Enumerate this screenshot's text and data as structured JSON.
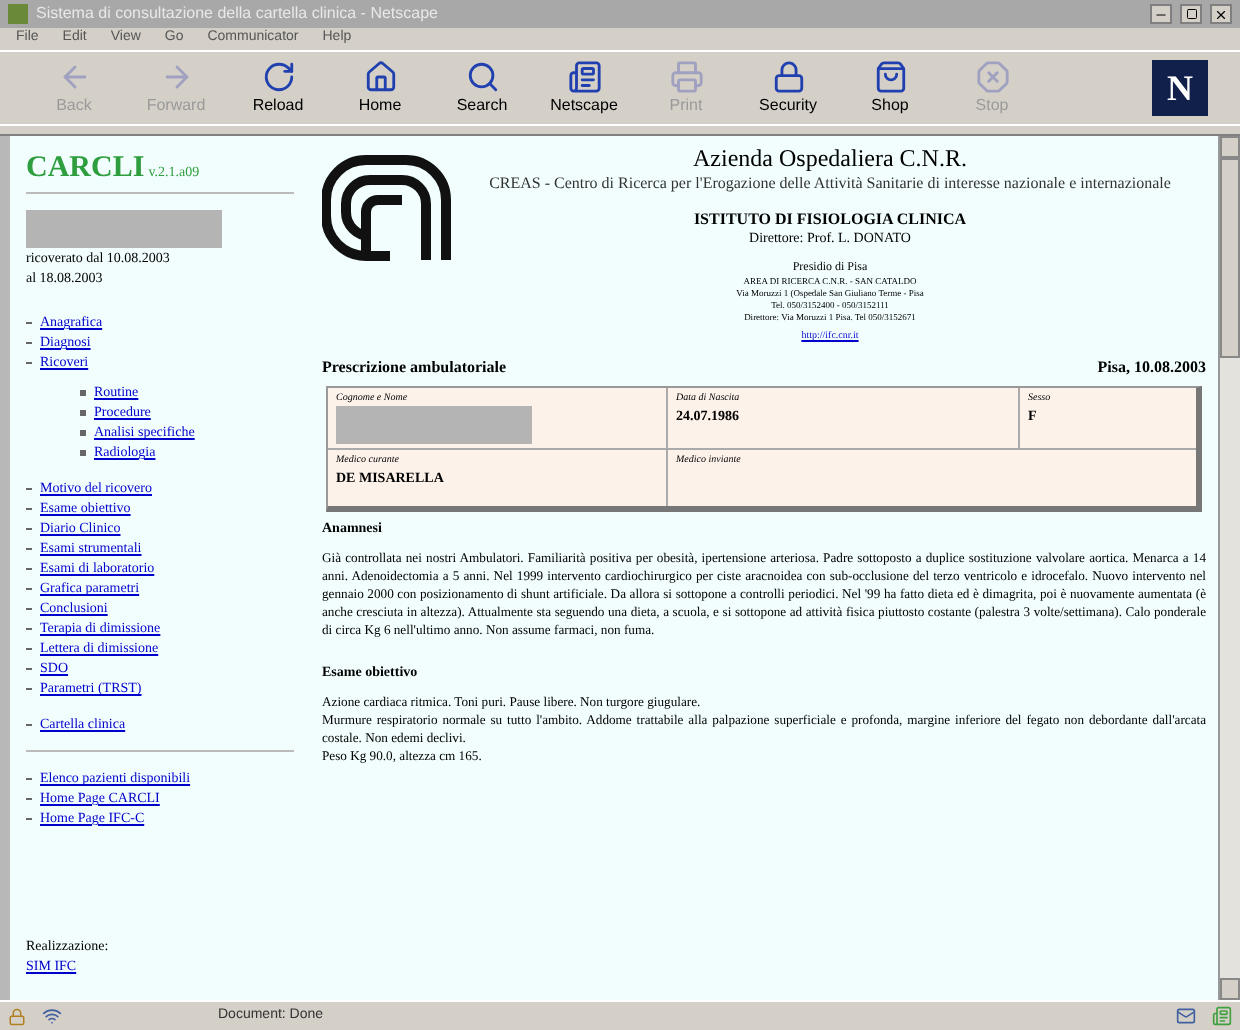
{
  "window": {
    "title": "Sistema di consultazione della cartella clinica - Netscape"
  },
  "menu": [
    "File",
    "Edit",
    "View",
    "Go",
    "Communicator",
    "Help"
  ],
  "toolbar": [
    {
      "kind": "back",
      "label": "Back",
      "disabled": true
    },
    {
      "kind": "forward",
      "label": "Forward",
      "disabled": true
    },
    {
      "kind": "reload",
      "label": "Reload",
      "disabled": false
    },
    {
      "kind": "home",
      "label": "Home",
      "disabled": false
    },
    {
      "kind": "search",
      "label": "Search",
      "disabled": false
    },
    {
      "kind": "netscape",
      "label": "Netscape",
      "disabled": false
    },
    {
      "kind": "print",
      "label": "Print",
      "disabled": true
    },
    {
      "kind": "security",
      "label": "Security",
      "disabled": false
    },
    {
      "kind": "shop",
      "label": "Shop",
      "disabled": false
    },
    {
      "kind": "stop",
      "label": "Stop",
      "disabled": true
    }
  ],
  "throbber": "N",
  "sidebar": {
    "app_name": "CARCLI",
    "version": "v.2.1.a09",
    "stay": [
      "ricoverato dal 10.08.2003",
      "al 18.08.2003"
    ],
    "links": [
      {
        "label": "Anagrafica"
      },
      {
        "label": "Diagnosi"
      },
      {
        "label": "Ricoveri",
        "children": [
          {
            "label": "Routine"
          },
          {
            "label": "Procedure"
          },
          {
            "label": "Analisi specifiche"
          },
          {
            "label": "Radiologia"
          }
        ]
      }
    ],
    "sections": [
      {
        "label": "Motivo del ricovero"
      },
      {
        "label": "Esame obiettivo"
      },
      {
        "label": "Diario Clinico"
      },
      {
        "label": "Esami strumentali"
      },
      {
        "label": "Esami di laboratorio"
      },
      {
        "label": "Grafica parametri"
      },
      {
        "label": "Conclusioni"
      },
      {
        "label": "Terapia di dimissione"
      },
      {
        "label": "Lettera di dimissione"
      },
      {
        "label": "SDO"
      },
      {
        "label": "Parametri (TRST)"
      }
    ],
    "record_link": "Cartella clinica",
    "footer_links": [
      "Elenco pazienti disponibili",
      "Home Page CARCLI",
      "Home Page IFC-C"
    ],
    "credits_label": "Realizzazione:",
    "credits_link": "SIM IFC"
  },
  "header": {
    "title": "Azienda Ospedaliera C.N.R.",
    "subtitle": "CREAS - Centro di Ricerca per l'Erogazione delle Attività Sanitarie di interesse nazionale e internazionale",
    "institute": "ISTITUTO DI FISIOLOGIA CLINICA",
    "director": "Direttore: Prof. L. DONATO",
    "site": "Presidio di Pisa",
    "address": [
      "AREA DI RICERCA C.N.R. - SAN CATALDO",
      "Via Moruzzi 1 (Ospedale San Giuliano Terme - Pisa",
      "Tel. 050/3152400 - 050/3152111",
      "Direttore: Via Moruzzi 1 Pisa. Tel 050/3152671"
    ],
    "url": "http://ifc.cnr.it"
  },
  "document": {
    "title": "Prescrizione ambulatoriale",
    "date": "Pisa, 10.08.2003",
    "patient": {
      "name_label": "Cognome e Nome",
      "birth_label": "Data di Nascita",
      "birth": "24.07.1986",
      "sex_label": "Sesso",
      "sex": "F",
      "doctor_label": "Medico curante",
      "doctor": "DE MISARELLA",
      "referrer_label": "Medico inviante"
    },
    "sections": [
      {
        "heading": "Anamnesi",
        "paragraphs": [
          "Già controllata nei nostri Ambulatori. Familiarità positiva per obesità, ipertensione arteriosa. Padre sottoposto a duplice sostituzione valvolare aortica. Menarca a 14 anni. Adenoidectomia a 5 anni. Nel 1999 intervento cardiochirurgico per ciste aracnoidea con sub-occlusione del terzo ventricolo e idrocefalo. Nuovo intervento nel gennaio 2000 con posizionamento di shunt artificiale. Da allora si sottopone a controlli periodici. Nel '99 ha fatto dieta ed è dimagrita, poi è nuovamente aumentata (è anche cresciuta in altezza). Attualmente sta seguendo una dieta, a scuola, e si sottopone ad attività fisica piuttosto costante (palestra 3 volte/settimana). Calo ponderale di circa Kg 6 nell'ultimo anno. Non assume farmaci, non fuma."
        ]
      },
      {
        "heading": "Esame obiettivo",
        "paragraphs": [
          "Azione cardiaca ritmica. Toni puri. Pause libere. Non turgore giugulare.",
          "Murmure respiratorio normale su tutto l'ambito. Addome trattabile alla palpazione superficiale e profonda, margine inferiore del fegato non debordante dall'arcata costale. Non edemi declivi.",
          "Peso Kg 90.0, altezza cm 165."
        ]
      }
    ]
  },
  "status_bar": {
    "text": "Document: Done"
  }
}
